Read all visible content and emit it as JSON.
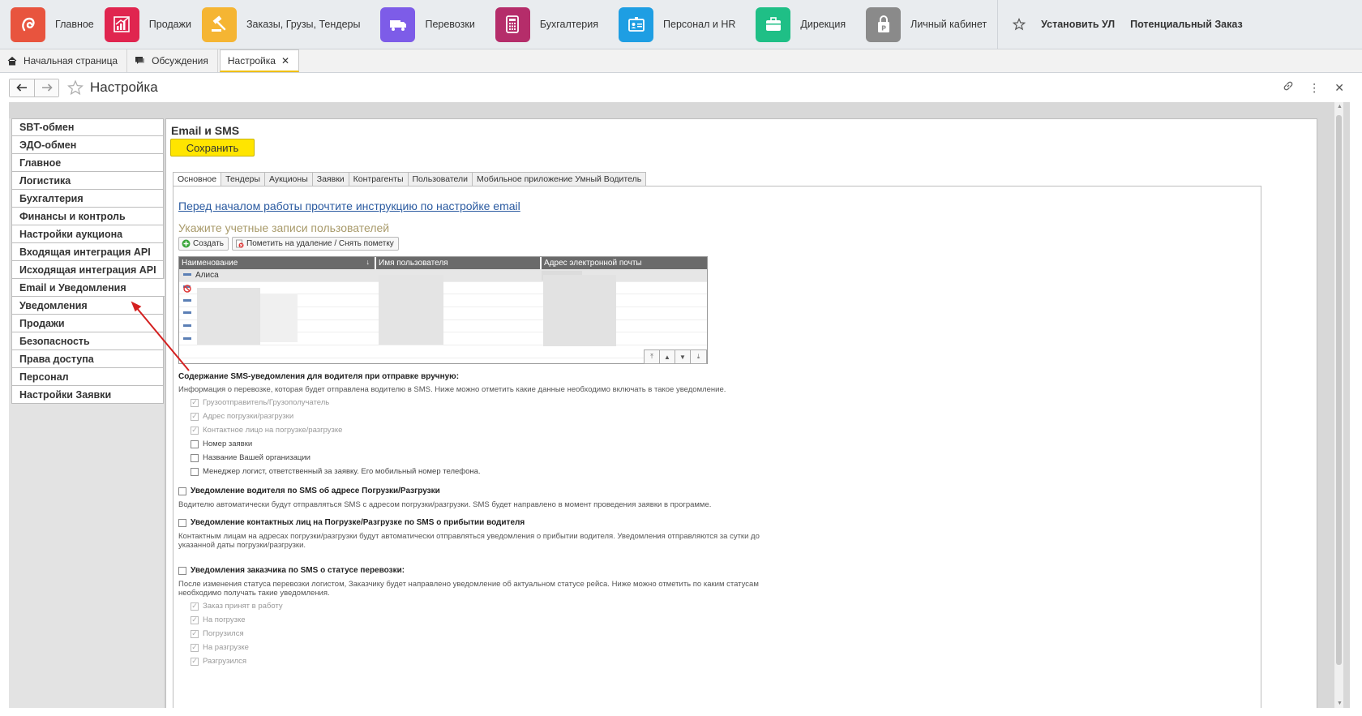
{
  "modules": [
    {
      "label": "Главное",
      "icon": "home-module-icon",
      "color": "#e8543e"
    },
    {
      "label": "Продажи",
      "icon": "sales-chart-icon",
      "color": "#e0254f"
    },
    {
      "label": "Заказы,  Грузы, Тендеры",
      "icon": "gavel-icon",
      "color": "#f5b533"
    },
    {
      "label": "Перевозки",
      "icon": "truck-icon",
      "color": "#7d5ce8"
    },
    {
      "label": "Бухгалтерия",
      "icon": "calculator-icon",
      "color": "#b52d6a"
    },
    {
      "label": "Персонал и HR",
      "icon": "badge-icon",
      "color": "#1e9ee3"
    },
    {
      "label": "Дирекция",
      "icon": "briefcase-icon",
      "color": "#1fbf86"
    },
    {
      "label": "Личный кабинет",
      "icon": "document-lock-icon",
      "color": "#8a8a8a"
    }
  ],
  "top_links": {
    "install": "Установить УЛ",
    "potential": "Потенциальный Заказ"
  },
  "page_tabs": [
    {
      "label": "Начальная страница"
    },
    {
      "label": "Обсуждения"
    },
    {
      "label": "Настройка"
    }
  ],
  "form": {
    "title": "Настройка"
  },
  "left_nav": [
    "SBT-обмен",
    "ЭДО-обмен",
    "Главное",
    "Логистика",
    "Бухгалтерия",
    "Финансы и контроль",
    "Настройки аукциона",
    "Входящая интеграция API",
    "Исходящая интеграция API",
    "Email и Уведомления",
    "Уведомления",
    "Продажи",
    "Безопасность",
    "Права доступа",
    "Персонал",
    "Настройки Заявки"
  ],
  "panel": {
    "title": "Email и SMS",
    "save_label": "Сохранить",
    "tabs": [
      "Основное",
      "Тендеры",
      "Аукционы",
      "Заявки",
      "Контрагенты",
      "Пользователи",
      "Мобильное приложение Умный Водитель"
    ],
    "instruction_link": "Перед началом работы прочтите инструкцию по настройке email",
    "accounts_title": "Укажите учетные записи пользователей",
    "create_label": "Создать",
    "mark_delete_label": "Пометить на удаление / Снять пометку",
    "grid": {
      "columns": [
        "Наименование",
        "Имя пользователя",
        "Адрес электронной почты"
      ],
      "first_row_name": "Алиса"
    },
    "sms_content": {
      "title": "Содержание SMS-уведомления для водителя при отправке вручную:",
      "info": "Информация о перевозке, которая будет отправлена водителю в SMS. Ниже можно отметить какие данные необходимо включать в такое уведомление.",
      "options": [
        {
          "label": "Грузоотправитель/Грузополучатель",
          "checked": true
        },
        {
          "label": "Адрес погрузки/разгрузки",
          "checked": true
        },
        {
          "label": "Контактное лицо на погрузке/разгрузке",
          "checked": true
        },
        {
          "label": "Номер заявки",
          "checked": false
        },
        {
          "label": "Название Вашей организации",
          "checked": false
        },
        {
          "label": "Менеджер логист, ответственный за заявку. Его мобильный номер телефона.",
          "checked": false
        }
      ]
    },
    "driver_notify": {
      "title": "Уведомление водителя по SMS об адресе Погрузки/Разгрузки",
      "info": "Водителю автоматически будут отправляться SMS с адресом погрузки/разгрузки. SMS будет направлено в момент проведения заявки в программе."
    },
    "contacts_notify": {
      "title": "Уведомление контактных лиц на Погрузке/Разгрузке по SMS о прибытии водителя",
      "info_line1": "Контактным лицам на адресах погрузки/разгрузки будут автоматически отправляться уведомления о прибытии водителя. Уведомления отправляются за сутки до",
      "info_line2": "указанной даты погрузки/разгрузки."
    },
    "customer_notify": {
      "title": "Уведомления заказчика по SMS о статусе перевозки:",
      "info_line1": "После изменения статуса перевозки логистом, Заказчику будет направлено уведомление об актуальном статусе рейса. Ниже можно отметить по каким статусам",
      "info_line2": "необходимо получать такие уведомления.",
      "options": [
        {
          "label": "Заказ принят в работу",
          "checked": true
        },
        {
          "label": "На погрузке",
          "checked": true
        },
        {
          "label": "Погрузился",
          "checked": true
        },
        {
          "label": "На разгрузке",
          "checked": true
        },
        {
          "label": "Разгрузился",
          "checked": true
        }
      ]
    }
  }
}
